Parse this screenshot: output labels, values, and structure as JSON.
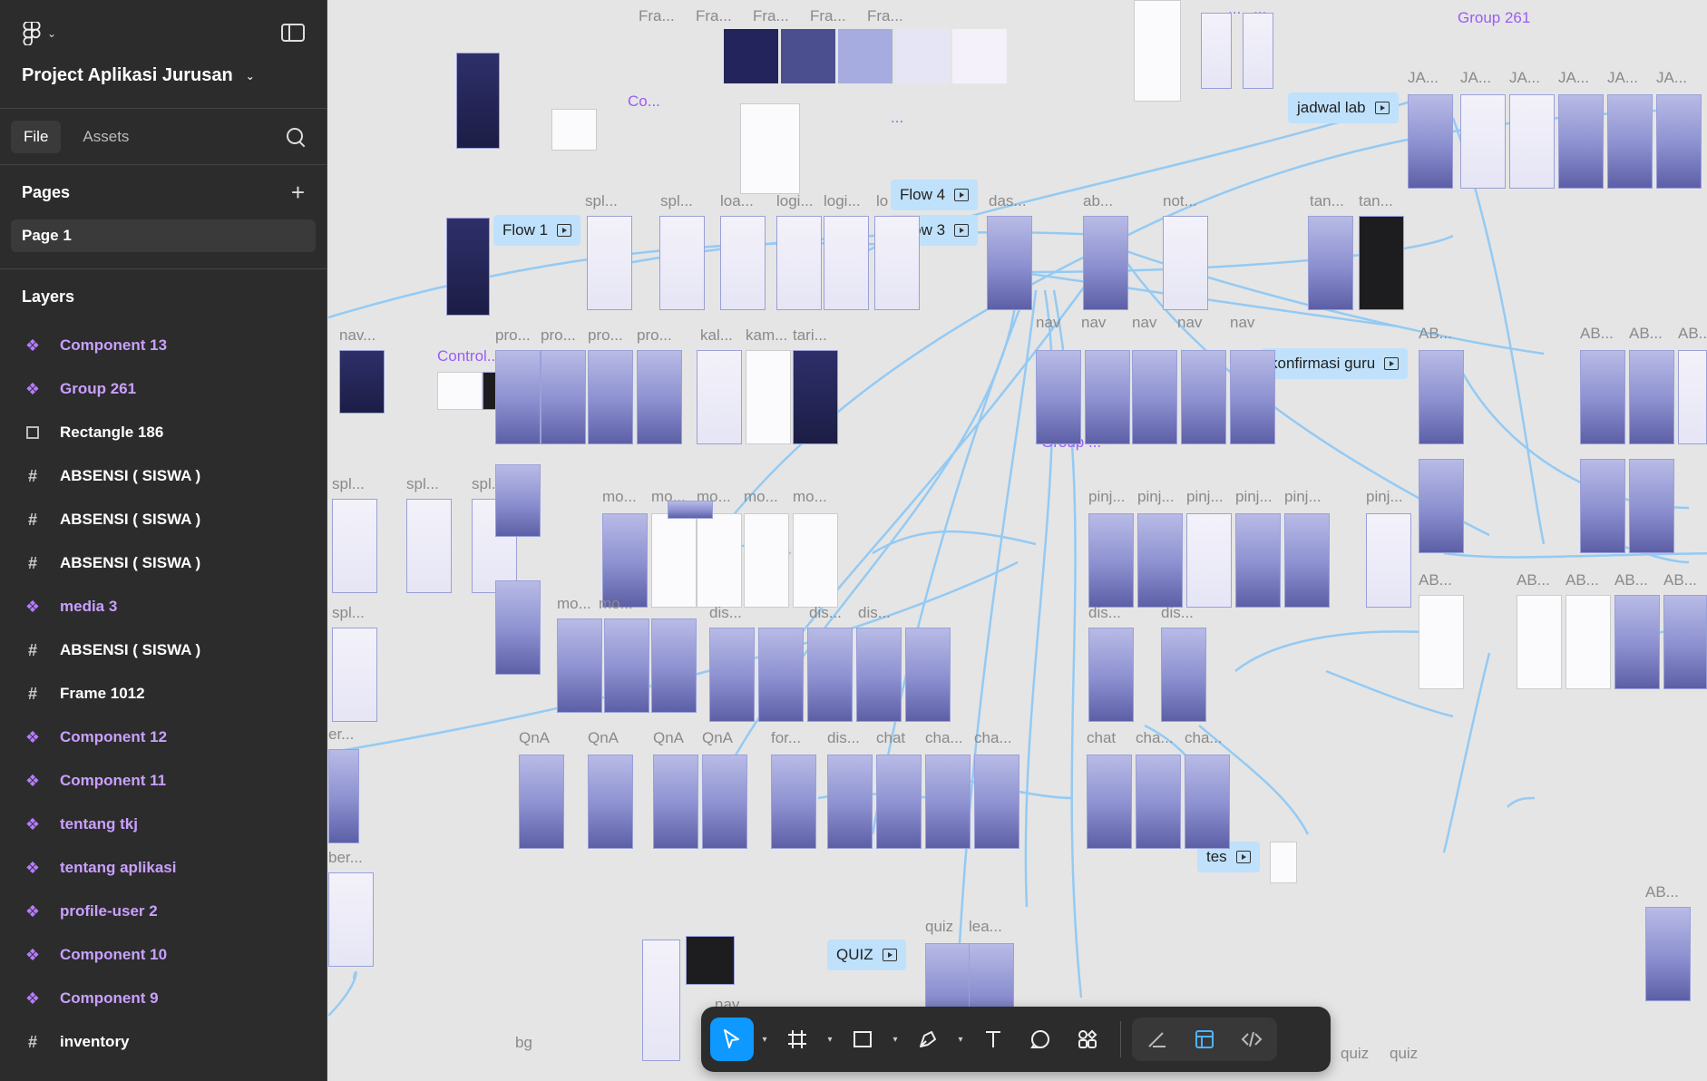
{
  "project": {
    "title": "Project Aplikasi Jurusan"
  },
  "tabs": [
    "File",
    "Assets"
  ],
  "pages": {
    "heading": "Pages",
    "items": [
      "Page 1"
    ]
  },
  "layers": {
    "heading": "Layers",
    "items": [
      {
        "name": "Component 13",
        "type": "component"
      },
      {
        "name": "Group 261",
        "type": "component"
      },
      {
        "name": "Rectangle 186",
        "type": "rectangle"
      },
      {
        "name": "ABSENSI ( SISWA )",
        "type": "frame"
      },
      {
        "name": "ABSENSI ( SISWA )",
        "type": "frame"
      },
      {
        "name": "ABSENSI ( SISWA )",
        "type": "frame"
      },
      {
        "name": "media 3",
        "type": "component"
      },
      {
        "name": "ABSENSI ( SISWA )",
        "type": "frame"
      },
      {
        "name": "Frame 1012",
        "type": "frame"
      },
      {
        "name": "Component 12",
        "type": "component"
      },
      {
        "name": "Component 11",
        "type": "component"
      },
      {
        "name": "tentang tkj",
        "type": "component"
      },
      {
        "name": "tentang aplikasi",
        "type": "component"
      },
      {
        "name": "profile-user 2",
        "type": "component"
      },
      {
        "name": "Component 10",
        "type": "component"
      },
      {
        "name": "Component 9",
        "type": "component"
      },
      {
        "name": "inventory",
        "type": "frame"
      }
    ]
  },
  "canvas": {
    "flows": [
      "Flow 1",
      "Flow 4",
      "Flow 3",
      "jadwal lab",
      "konfirmasi guru",
      "tes",
      "QUIZ"
    ],
    "component_labels": [
      "Co...",
      "...",
      "Control...",
      "Group ...",
      "Group 261",
      "...",
      "..."
    ],
    "frame_labels": {
      "fra": "Fra...",
      "spl": "spl...",
      "loa": "loa...",
      "logi": "logi...",
      "lo": "lo",
      "das": "das...",
      "ab": "ab...",
      "not": "not...",
      "tan": "tan...",
      "nav": "nav...",
      "pro": "pro...",
      "kal": "kal...",
      "kam": "kam...",
      "tari": "tari...",
      "navshort": "nav",
      "jadwal": "JA...",
      "abs": "AB...",
      "mo": "mo...",
      "pinj": "pinj...",
      "dis": "dis...",
      "qna": "QnA",
      "for": "for...",
      "chat": "chat",
      "cha": "cha...",
      "quiz": "quiz",
      "lea": "lea...",
      "bg": "bg",
      "er": "er...",
      "ber": "ber...",
      "nay": "nay"
    },
    "swatch_colors": [
      "#24245c",
      "#4b4f8f",
      "#a6abe0",
      "#e6e5f5",
      "#f4f1fa"
    ]
  },
  "toolbar": {
    "tools": [
      "move-tool",
      "frame-tool",
      "shape-tool",
      "pen-tool",
      "text-tool",
      "comment-tool",
      "actions-tool",
      "draw-mode",
      "design-mode",
      "dev-mode"
    ],
    "active": "move-tool"
  },
  "colors": {
    "sidebar_bg": "#2c2c2c",
    "canvas_bg": "#e5e5e5",
    "component_purple": "#c9a0ff",
    "flow_blue": "#bfe1fb",
    "prototype_line": "#8cc8f5",
    "active_tool": "#0d99ff"
  }
}
